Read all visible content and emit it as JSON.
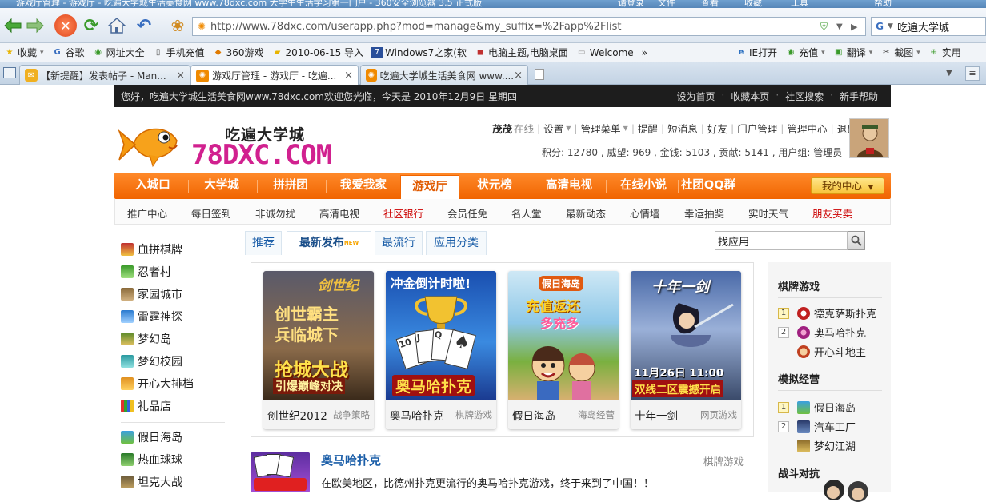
{
  "browser": {
    "window_title": "游戏厅管理 - 游戏厅 - 吃遍大学城生活美食网 www.78dxc.com 大学生生活学习第一门户 - 360安全浏览器 3.5 正式版",
    "title_right": [
      "请登录",
      "文件",
      "查看",
      "收藏",
      "工具",
      "帮助"
    ],
    "url": "http://www.78dxc.com/userapp.php?mod=manage&my_suffix=%2Fapp%2Flist",
    "search_value": "吃遍大学城",
    "bookmarks": [
      "收藏",
      "谷歌",
      "网址大全",
      "手机充值",
      "360游戏",
      "2010-06-15 导入",
      "Windows7之家(软",
      "电脑主题,电脑桌面",
      "Welcome",
      "»",
      "IE打开",
      "充值",
      "翻译",
      "截图",
      "实用"
    ],
    "tabs": [
      {
        "label": "【新提醒】发表帖子 - Man...",
        "close": "×"
      },
      {
        "label": "游戏厅管理 - 游戏厅 - 吃遍...",
        "close": "×"
      },
      {
        "label": "吃遍大学城生活美食网 www....",
        "close": "×"
      }
    ]
  },
  "colors": {
    "brand_orange": "#f06400",
    "link_blue": "#1b5ea8",
    "logo_pink": "#d1218f"
  },
  "topstrip": {
    "welcome": "您好，吃遍大学城生活美食网www.78dxc.com欢迎您光临，今天是 2010年12月9日 星期四",
    "links": [
      "设为首页",
      "收藏本页",
      "社区搜索",
      "新手帮助"
    ],
    "sep": "·"
  },
  "header": {
    "logo_cn": "吃遍大学城",
    "logo_en": "78DXC.COM",
    "username": "茂茂",
    "online": "在线",
    "menu": [
      "设置",
      "管理菜单",
      "提醒",
      "短消息",
      "好友",
      "门户管理",
      "管理中心",
      "退出"
    ],
    "stats": "积分: 12780 , 威望: 969 , 金钱: 5103 , 贡献: 5141 , 用户组: 管理员"
  },
  "mainnav": {
    "items": [
      "入城口",
      "大学城",
      "拼拼团",
      "我爱我家",
      "游戏厅",
      "状元榜",
      "高清电视",
      "在线小说",
      "社团QQ群"
    ],
    "active": "游戏厅",
    "my_center": "我的中心"
  },
  "subnav": [
    "推广中心",
    "每日签到",
    "非诚勿扰",
    "高清电视",
    "社区银行",
    "会员任免",
    "名人堂",
    "最新动态",
    "心情墙",
    "幸运抽奖",
    "实时天气",
    "朋友买卖"
  ],
  "left_games": [
    "血拼棋牌",
    "忍者村",
    "家园城市",
    "雷霆神探",
    "梦幻岛",
    "梦幻校园",
    "开心大排档",
    "礼品店",
    "假日海岛",
    "热血球球",
    "坦克大战"
  ],
  "game_tabs": [
    "推荐",
    "最新发布",
    "最流行",
    "应用分类"
  ],
  "new_badge": "NEW",
  "app_search": {
    "value": "找应用"
  },
  "featured": [
    {
      "name": "创世纪2012",
      "category": "战争策略",
      "art_lines": [
        "剑世纪",
        "创世霸主",
        "兵临城下",
        "抢城大战",
        "引爆巅峰对决"
      ]
    },
    {
      "name": "奥马哈扑克",
      "category": "棋牌游戏",
      "art_lines": [
        "冲金倒计时啦!",
        "奥马哈扑克"
      ]
    },
    {
      "name": "假日海岛",
      "category": "海岛经营",
      "art_lines": [
        "假日海岛",
        "充值返还",
        "多充多"
      ]
    },
    {
      "name": "十年一剑",
      "category": "网页游戏",
      "art_lines": [
        "十年一剑",
        "11月26日 11:00",
        "双线二区震撼开启"
      ]
    }
  ],
  "detail": {
    "title": "奥马哈扑克",
    "category": "棋牌游戏",
    "description": "在欧美地区，比德州扑克更流行的奥马哈扑克游戏，终于来到了中国！！"
  },
  "right_sidebar": {
    "sections": [
      {
        "title": "棋牌游戏",
        "items": [
          {
            "rank": "1",
            "name": "德克萨斯扑克"
          },
          {
            "rank": "2",
            "name": "奥马哈扑克"
          },
          {
            "rank": "",
            "name": "开心斗地主"
          }
        ]
      },
      {
        "title": "模拟经营",
        "items": [
          {
            "rank": "1",
            "name": "假日海岛"
          },
          {
            "rank": "2",
            "name": "汽车工厂"
          },
          {
            "rank": "",
            "name": "梦幻江湖"
          }
        ]
      },
      {
        "title": "战斗对抗",
        "items": []
      }
    ]
  }
}
